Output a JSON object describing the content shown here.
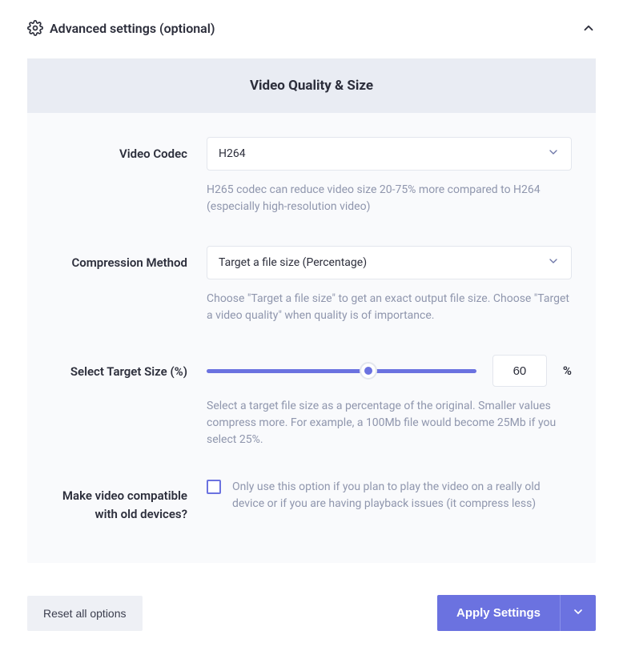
{
  "header": {
    "title": "Advanced settings (optional)"
  },
  "panel": {
    "title": "Video Quality & Size"
  },
  "fields": {
    "codec": {
      "label": "Video Codec",
      "value": "H264",
      "helper": "H265 codec can reduce video size 20-75% more compared to H264 (especially high-resolution video)"
    },
    "method": {
      "label": "Compression Method",
      "value": "Target a file size (Percentage)",
      "helper": "Choose \"Target a file size\" to get an exact output file size. Choose \"Target a video quality\" when quality is of importance."
    },
    "target": {
      "label": "Select Target Size (%)",
      "value": "60",
      "unit": "%",
      "helper": "Select a target file size as a percentage of the original. Smaller values compress more. For example, a 100Mb file would become 25Mb if you select 25%."
    },
    "compat": {
      "label": "Make video compatible with old devices?",
      "helper": "Only use this option if you plan to play the video on a really old device or if you are having playback issues (it compress less)"
    }
  },
  "footer": {
    "reset": "Reset all options",
    "apply": "Apply Settings"
  }
}
